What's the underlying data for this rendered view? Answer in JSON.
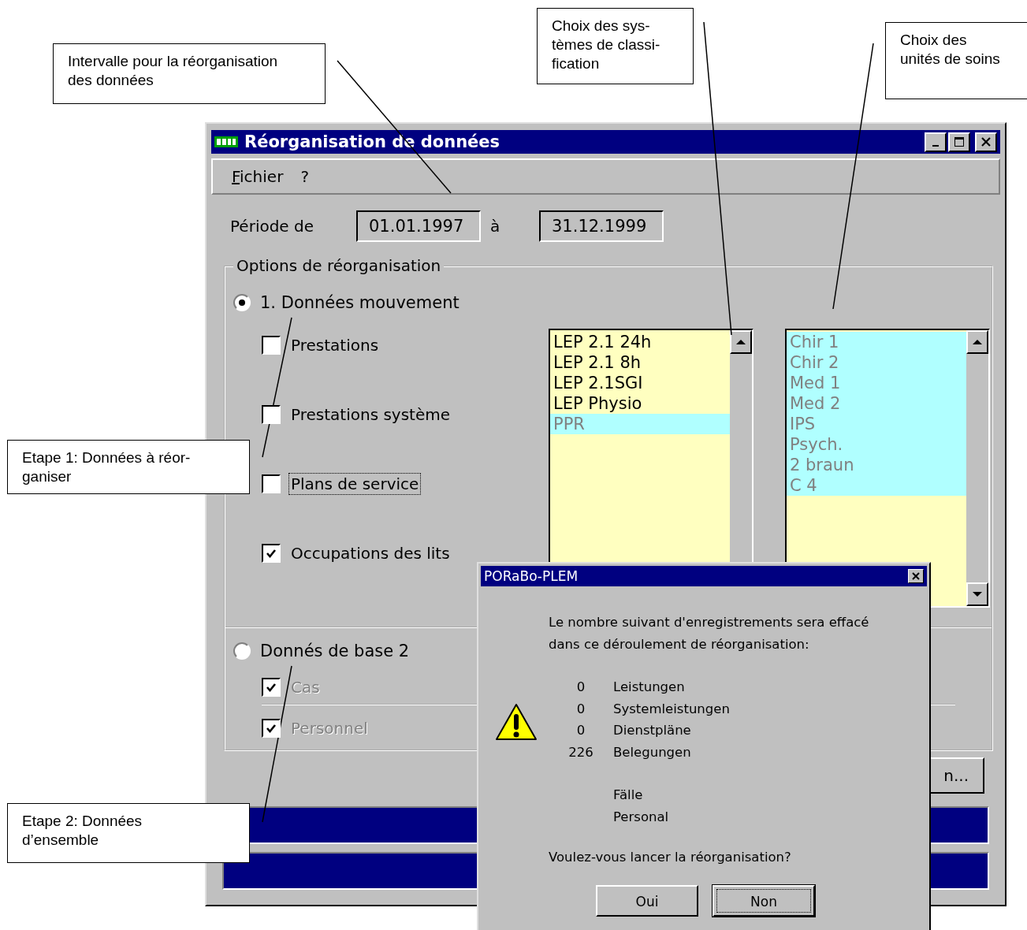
{
  "callouts": [
    {
      "lines": [
        "Intervalle pour la réorganisation",
        "des données"
      ]
    },
    {
      "lines": [
        "Choix des sys-",
        "tèmes de classi-",
        "fication"
      ]
    },
    {
      "lines": [
        "Choix des",
        "unités de soins"
      ]
    },
    {
      "lines": [
        "Etape 1: Données à réor-",
        "ganiser"
      ]
    },
    {
      "lines": [
        "Etape  2: Données",
        "d’ensemble"
      ]
    }
  ],
  "window": {
    "title": "Réorganisation de données",
    "menu": [
      "Fichier",
      "?"
    ],
    "period": {
      "label": "Période de",
      "from": "01.01.1997",
      "separator": "à",
      "to": "31.12.1999"
    },
    "group": {
      "legend": "Options de réorganisation",
      "options": [
        {
          "label": "1. Données mouvement",
          "selected": true,
          "items": [
            {
              "label": "Prestations",
              "checked": false,
              "disabled": false,
              "focused": false
            },
            {
              "label": "Prestations système",
              "checked": false,
              "disabled": false,
              "focused": false
            },
            {
              "label": "Plans de service",
              "checked": false,
              "disabled": false,
              "focused": true
            },
            {
              "label": "Occupations des lits",
              "checked": true,
              "disabled": false,
              "focused": false
            }
          ]
        },
        {
          "label": "Donnés de base 2",
          "selected": false,
          "items": [
            {
              "label": "Cas",
              "checked": true,
              "disabled": true,
              "focused": false
            },
            {
              "label": "Personnel",
              "checked": true,
              "disabled": true,
              "focused": false
            }
          ]
        }
      ]
    },
    "lists": [
      {
        "items": [
          {
            "text": "LEP 2.1 24h",
            "selected": false
          },
          {
            "text": "LEP 2.1 8h",
            "selected": false
          },
          {
            "text": "LEP 2.1SGI",
            "selected": false
          },
          {
            "text": "LEP Physio",
            "selected": false
          },
          {
            "text": "PPR",
            "selected": true
          }
        ]
      },
      {
        "items": [
          {
            "text": "Chir 1",
            "selected": true
          },
          {
            "text": "Chir 2",
            "selected": true
          },
          {
            "text": "Med 1",
            "selected": true
          },
          {
            "text": "Med 2",
            "selected": true
          },
          {
            "text": "IPS",
            "selected": true
          },
          {
            "text": "Psych.",
            "selected": true
          },
          {
            "text": "2 braun",
            "selected": true
          },
          {
            "text": "C 4",
            "selected": true
          }
        ]
      }
    ],
    "button": "n...",
    "progress_bars": [
      {
        "level": 1
      },
      {
        "level": 1
      }
    ]
  },
  "dialog": {
    "title": "PORaBo-PLEM",
    "message": "Le nombre suivant d'enregistrements sera effacé dans ce déroulement de réorganisation:",
    "rows": [
      {
        "count": "0",
        "label": "Leistungen"
      },
      {
        "count": "0",
        "label": "Systemleistungen"
      },
      {
        "count": "0",
        "label": "Dienstpläne"
      },
      {
        "count": "226",
        "label": "Belegungen"
      },
      {
        "label": "Fälle"
      },
      {
        "label": "Personal"
      }
    ],
    "question": "Voulez-vous lancer la réorganisation?",
    "buttons": [
      {
        "label": "Oui",
        "default": false
      },
      {
        "label": "Non",
        "default": true
      }
    ]
  }
}
